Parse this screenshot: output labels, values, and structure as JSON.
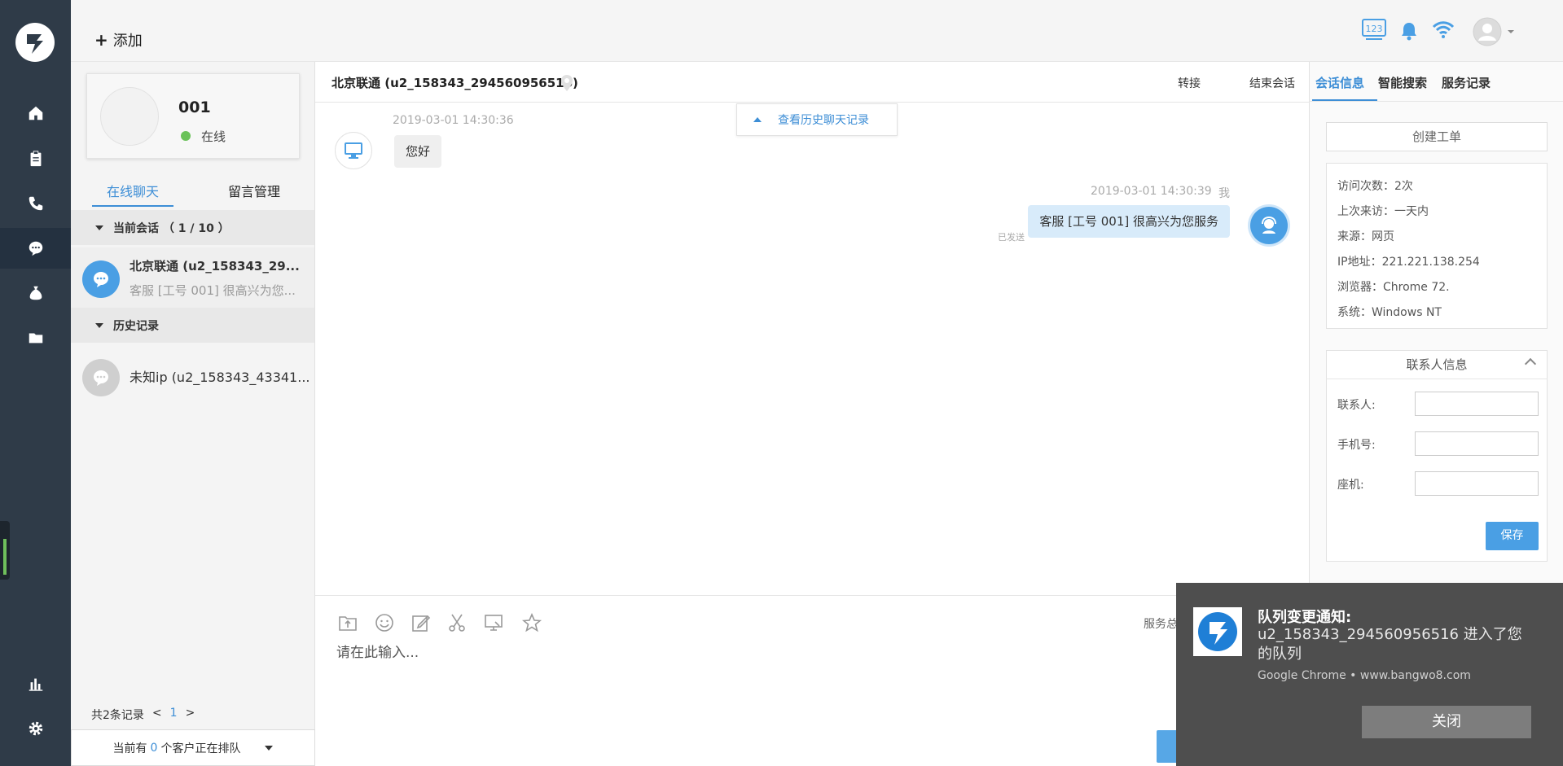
{
  "topbar": {
    "add_label": "添加",
    "badge_text": "123"
  },
  "agent": {
    "id": "001",
    "status": "在线"
  },
  "left_tabs": {
    "online_chat": "在线聊天",
    "message_mgmt": "留言管理"
  },
  "sections": {
    "current": "当前会话 （ 1 / 10 ）",
    "history": "历史记录"
  },
  "sessions": [
    {
      "title": "北京联通 (u2_158343_29...",
      "preview": "客服 [工号 001] 很高兴为您..."
    }
  ],
  "history_sessions": [
    {
      "title": "未知ip (u2_158343_43341..."
    }
  ],
  "pager": {
    "total": "共2条记录",
    "prev": "<",
    "page": "1",
    "next": ">"
  },
  "queue": {
    "prefix": "当前有",
    "count": "0",
    "suffix": "个客户正在排队"
  },
  "chat": {
    "title": "北京联通 (u2_158343_294560956516)",
    "transfer": "转接",
    "end": "结束会话",
    "history_link": "查看历史聊天记录",
    "messages": [
      {
        "time": "2019-03-01 14:30:36",
        "text": "您好"
      },
      {
        "time": "2019-03-01 14:30:39",
        "self": "我",
        "text": "客服 [工号 001] 很高兴为您服务",
        "status": "已发送"
      }
    ],
    "input_placeholder": "请在此输入...",
    "service_summary": "服务总"
  },
  "right": {
    "tabs": [
      "会话信息",
      "智能搜索",
      "服务记录"
    ],
    "create_order": "创建工单",
    "visit": [
      "访问次数：2次",
      "上次来访：一天内",
      "来源：网页",
      "IP地址：221.221.138.254",
      "浏览器：Chrome 72.",
      "系统：Windows NT"
    ],
    "contact_title": "联系人信息",
    "contact_labels": [
      "联系人:",
      "手机号:",
      "座机:"
    ],
    "save": "保存"
  },
  "notification": {
    "title": "队列变更通知:",
    "body": "u2_158343_294560956516 进入了您的队列",
    "source": "Google Chrome • www.bangwo8.com",
    "close": "关闭"
  },
  "colors": {
    "nav_bg": "#2f3b48",
    "accent": "#3d8ed6",
    "online": "#6ac259",
    "notify_bg": "#4e4e4e"
  }
}
